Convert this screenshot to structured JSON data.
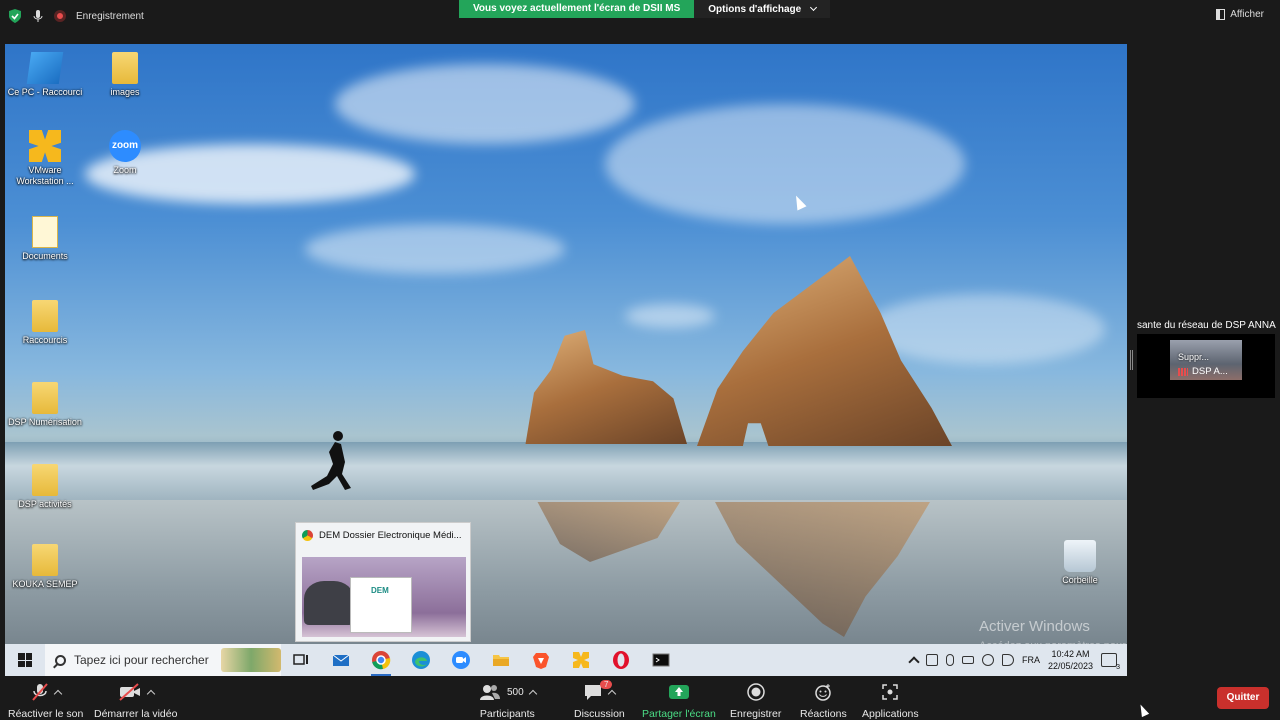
{
  "topbar": {
    "recording_label": "Enregistrement",
    "share_banner": "Vous voyez actuellement l'écran de DSII MS",
    "view_options": "Options d'affichage",
    "show_label": "Afficher"
  },
  "desktop": {
    "icons": [
      {
        "label": "Ce PC - Raccourci",
        "icon": "pc-icon"
      },
      {
        "label": "images",
        "icon": "folder-icon"
      },
      {
        "label": "VMware Workstation ...",
        "icon": "vmware-icon"
      },
      {
        "label": "Zoom",
        "icon": "zoom-icon"
      },
      {
        "label": "Documents",
        "icon": "documents-icon"
      },
      {
        "label": "Raccourcis",
        "icon": "folder-icon"
      },
      {
        "label": "DSP Numérisation",
        "icon": "folder-icon"
      },
      {
        "label": "DSP activités",
        "icon": "folder-icon"
      },
      {
        "label": "KOUKA SEMEP",
        "icon": "folder-icon"
      },
      {
        "label": "Corbeille",
        "icon": "recycle-bin-icon"
      }
    ],
    "zoom_glyph": "zoom",
    "preview_title": "DEM Dossier Electronique Médi...",
    "preview_logo": "DEM",
    "activate_title": "Activer Windows",
    "activate_sub": "Accédez aux paramètres pour activer Windows."
  },
  "taskbar": {
    "search_placeholder": "Tapez ici pour rechercher",
    "apps": [
      "task-view-icon",
      "mail-icon",
      "chrome-icon",
      "edge-icon",
      "zoom-icon",
      "file-explorer-icon",
      "brave-icon",
      "vmware-icon",
      "opera-icon",
      "terminal-icon"
    ],
    "language": "FRA",
    "time": "10:42 AM",
    "date": "22/05/2023",
    "notification_count": "3"
  },
  "participant_panel": {
    "title": "sante du réseau de DSP ANNA",
    "tile_label": "Suppr...",
    "tile_name": "DSP A..."
  },
  "toolbar": {
    "unmute": "Réactiver le son",
    "start_video": "Démarrer la vidéo",
    "participants": "Participants",
    "participants_count": "500",
    "chat": "Discussion",
    "chat_badge": "7",
    "share_screen": "Partager l'écran",
    "record": "Enregistrer",
    "reactions": "Réactions",
    "apps": "Applications",
    "quit": "Quitter"
  },
  "colors": {
    "share_green": "#23a55a",
    "quit_red": "#c9302c",
    "zoom_blue": "#2d8cff"
  }
}
